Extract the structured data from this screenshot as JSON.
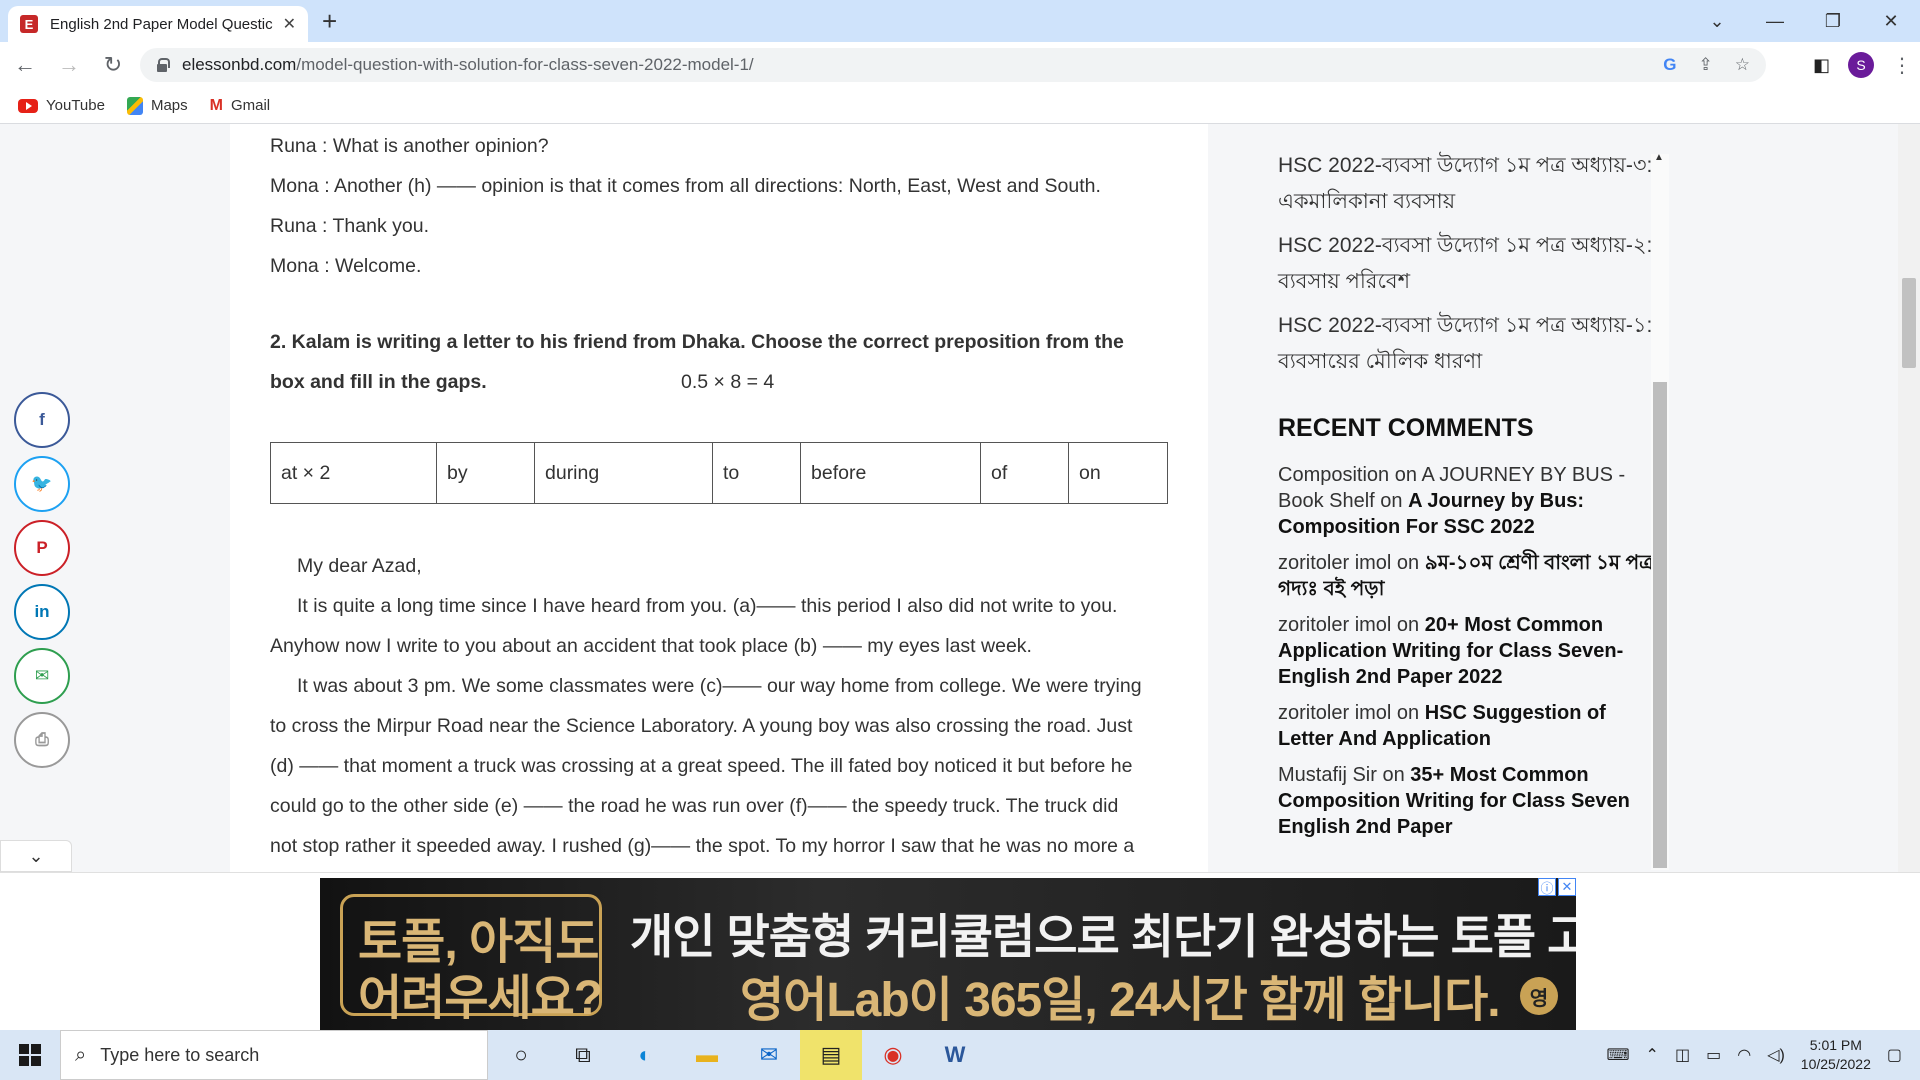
{
  "browser": {
    "tab_title": "English 2nd Paper Model Questic",
    "tab_favicon": "E",
    "new_tab": "+",
    "url_host": "elessonbd.com",
    "url_path": "/model-question-with-solution-for-class-seven-2022-model-1/",
    "profile_initial": "S",
    "bookmarks": [
      "YouTube",
      "Maps",
      "Gmail"
    ]
  },
  "article": {
    "dialogue": [
      "Runa : What is another opinion?",
      "Mona : Another (h) —— opinion is that it comes from all directions: North, East, West and South.",
      "Runa : Thank you.",
      "Mona : Welcome."
    ],
    "question2_line1": "2.  Kalam is writing a letter to his friend from Dhaka. Choose the correct preposition from the",
    "question2_line2": "box and fill in the gaps.",
    "question2_marks": "0.5 × 8 = 4",
    "prepositions": [
      "at × 2",
      "by",
      "during",
      "to",
      "before",
      "of",
      "on"
    ],
    "letter_lines": [
      "My dear Azad,",
      "It is quite a long time since I have heard from you. (a)—— this period I also did not write to you.",
      "Anyhow now I write to you about an accident that took place (b) —— my eyes last week.",
      "It was about 3 pm. We some classmates were (c)—— our way home from college. We were trying",
      "to cross the Mirpur Road near the Science Laboratory. A young boy was also crossing the road. Just",
      "(d) —— that moment a truck was crossing at a great speed. The ill fated boy noticed it but before he",
      "could go to the other side (e) —— the road he was run over (f)—— the speedy truck. The truck did",
      "not stop rather it speeded away. I rushed (g)—— the spot. To my horror I saw that he was no more a"
    ]
  },
  "sidebar": {
    "links": [
      "HSC 2022-ব্যবসা উদ্যোগ ১ম পত্র অধ্যায়-৩: একমালিকানা ব্যবসায়",
      "HSC 2022-ব্যবসা উদ্যোগ ১ম পত্র অধ্যায়-২: ব্যবসায় পরিবেশ",
      "HSC 2022-ব্যবসা উদ্যোগ ১ম পত্র অধ্যায়-১: ব্যবসায়ের মৌলিক ধারণা"
    ],
    "recent_comments_title": "RECENT COMMENTS",
    "comments": [
      {
        "author": "Composition",
        "on": "on",
        "post": "A JOURNEY BY BUS - Book Shelf",
        "on2": "on",
        "post2": "A Journey by Bus: Composition For SSC 2022"
      },
      {
        "author": "zoritoler imol",
        "on": "on",
        "post": "৯ম-১০ম শ্রেণী বাংলা ১ম পত্র গদ্যঃ বই পড়া"
      },
      {
        "author": "zoritoler imol",
        "on": "on",
        "post": "20+ Most Common Application Writing for Class Seven-English 2nd Paper 2022"
      },
      {
        "author": "zoritoler imol",
        "on": "on",
        "post": "HSC Suggestion of Letter And Application"
      },
      {
        "author": "Mustafij Sir",
        "on": "on",
        "post": "35+ Most Common Composition Writing for Class Seven English 2nd Paper"
      }
    ]
  },
  "share_buttons": [
    {
      "name": "facebook-icon",
      "glyph": "f",
      "color": "#3b5998"
    },
    {
      "name": "twitter-icon",
      "glyph": "🐦",
      "color": "#1da1f2"
    },
    {
      "name": "pinterest-icon",
      "glyph": "P",
      "color": "#cb2027"
    },
    {
      "name": "linkedin-icon",
      "glyph": "in",
      "color": "#0077b5"
    },
    {
      "name": "email-icon",
      "glyph": "✉",
      "color": "#2e9e4f"
    },
    {
      "name": "print-icon",
      "glyph": "⎙",
      "color": "#999999"
    }
  ],
  "ad": {
    "left_line1": "토플, 아직도",
    "left_line2": "어려우세요?",
    "headline": "개인 맞춤형 커리큘럼으로 최단기 완성하는 토플 고득점!",
    "subline": "영어Lab이 365일, 24시간 함께 합니다.",
    "logo": "영"
  },
  "taskbar": {
    "search_placeholder": "Type here to search",
    "time": "5:01 PM",
    "date": "10/25/2022"
  }
}
